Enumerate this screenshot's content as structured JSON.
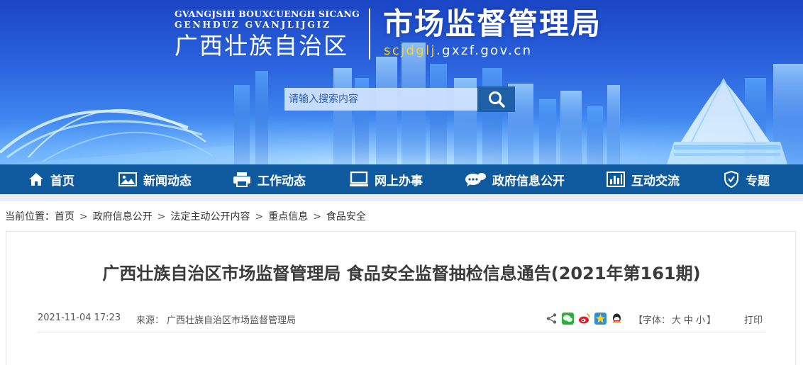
{
  "header": {
    "zhuang_line1": "GVANGJSIH BOUXCUENGH SICANG",
    "zhuang_line2": "GENHDUZ GVANJLIJGIZ",
    "region_name": "广西壮族自治区",
    "agency_name": "市场监督管理局",
    "domain_accent": "scjdglj",
    "domain_rest": ".gxzf.gov.cn"
  },
  "search": {
    "placeholder": "请输入搜索内容",
    "button_icon": "search-icon"
  },
  "nav": {
    "items": [
      {
        "label": "首页",
        "icon": "home-icon"
      },
      {
        "label": "新闻动态",
        "icon": "picture-icon"
      },
      {
        "label": "工作动态",
        "icon": "printer-icon"
      },
      {
        "label": "网上办事",
        "icon": "monitor-icon"
      },
      {
        "label": "政府信息公开",
        "icon": "chat-bubble-icon"
      },
      {
        "label": "互动交流",
        "icon": "bar-chart-icon"
      },
      {
        "label": "专题",
        "icon": "shield-icon"
      }
    ]
  },
  "breadcrumb": {
    "prefix": "当前位置：",
    "items": [
      "首页",
      "政府信息公开",
      "法定主动公开内容",
      "重点信息",
      "食品安全"
    ],
    "separator": ">"
  },
  "article": {
    "title": "广西壮族自治区市场监督管理局 食品安全监督抽检信息通告(2021年第161期)",
    "date": "2021-11-04 17:23",
    "source_label": "来源：",
    "source": "广西壮族自治区市场监督管理局",
    "share_icons": [
      "share-icon",
      "wechat-icon",
      "weibo-icon",
      "qzone-icon",
      "qq-icon"
    ],
    "font_size_prefix": "【字体：",
    "font_sizes": [
      "大",
      "中",
      "小"
    ],
    "font_size_suffix": "】",
    "print_label": "打印"
  },
  "colors": {
    "nav_bg": "#0f5a9e",
    "banner_top": "#1a45c4",
    "domain_accent": "#ffd21a",
    "search_button": "#1e5fa8"
  }
}
